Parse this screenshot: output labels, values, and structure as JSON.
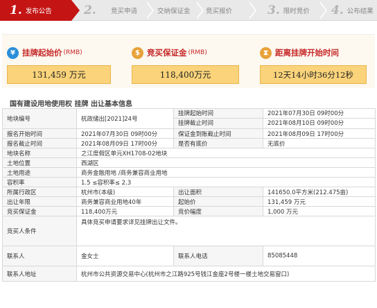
{
  "steps": [
    {
      "num": "1.",
      "label": "发布公告",
      "active": true
    },
    {
      "num": "2.",
      "label": "",
      "active": false
    },
    {
      "num": "",
      "label": "竞买申请",
      "active": false
    },
    {
      "num": "",
      "label": "交纳保证金",
      "active": false
    },
    {
      "num": "",
      "label": "竞买报价",
      "active": false
    },
    {
      "num": "3.",
      "label": "限时竞价",
      "active": false
    },
    {
      "num": "4.",
      "label": "公布结果",
      "active": false
    }
  ],
  "info": {
    "start_price": {
      "title": "挂牌起始价",
      "unit": "(RMB)",
      "value": "131,459 万元",
      "icon": "coins-icon",
      "color": "#2a8fd8"
    },
    "deposit": {
      "title": "竞买保证金",
      "unit": "(RMB)",
      "value": "118,400万元",
      "icon": "money-bag-icon",
      "color": "#e8a23a"
    },
    "countdown": {
      "title": "距离挂牌开始时间",
      "unit": "",
      "value": "12天14小时36分12秒",
      "icon": "hourglass-icon",
      "color": "#e8a23a"
    }
  },
  "section_title": "国有建设用地使用权 挂牌 出让基本信息",
  "table": {
    "parcel_no_label": "地块编号",
    "parcel_no": "杭政储出[2021]24号",
    "listing_start_label": "挂牌起始时间",
    "listing_start": "2021年07月30日 09时00分",
    "listing_end_label": "挂牌截止时间",
    "listing_end": "2021年08月10日 09时00分",
    "apply_start_label": "报名开始时间",
    "apply_start": "2021年07月30日 09时00分",
    "deposit_deadline_label": "保证金到账截止时间",
    "deposit_deadline": "2021年08月09日 17时00分",
    "apply_end_label": "报名截止时间",
    "apply_end": "2021年08月09日 17时00分",
    "reserve_label": "是否有底价",
    "reserve": "无底价",
    "parcel_name_label": "地块名称",
    "parcel_name": "之江度假区单元XH1708-02地块",
    "location_label": "土地位置",
    "location": "西湖区",
    "use_label": "土地用途",
    "use": "商务金融用地 /商务兼容商业用地",
    "far_label": "容积率",
    "far": "1.5 ≤容积率≤ 2.3",
    "district_label": "所属行政区",
    "district": "杭州市(本级)",
    "area_label": "出让面积",
    "area": "141650.0平方米(212.475亩)",
    "term_label": "出让年限",
    "term": "商务兼容商业用地40年",
    "start_price_label": "起始价",
    "start_price": "131,459 万元",
    "deposit_label": "竞买保证金",
    "deposit": "118,400万元",
    "increment_label": "竞价幅度",
    "increment": "1,000 万元",
    "condition_label": "竞买人条件",
    "condition": "具体竞买申请要求详见挂牌出让文件。",
    "contact_label": "联系人",
    "contact": "金女士",
    "phone_label": "联系人电话",
    "phone": "85085448",
    "address_label": "联系人地址",
    "address": "杭州市公共资源交易中心(杭州市之江路925号钱江金座2号楼一楼土地交易窗口)"
  }
}
